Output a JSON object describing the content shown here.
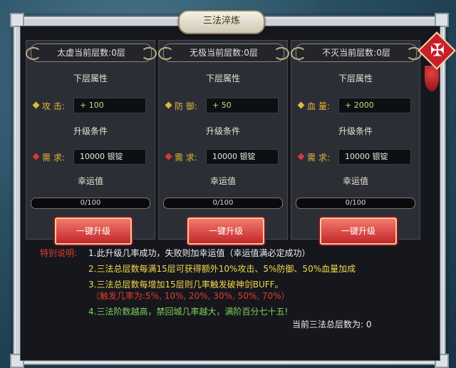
{
  "window": {
    "title": "三法淬炼",
    "close_icon": "✠"
  },
  "columns": [
    {
      "header": "太虚当前层数:0层",
      "next_attr": "下层属性",
      "stat": {
        "label": "攻  击:",
        "value": "+ 100"
      },
      "upgrade_cond": "升级条件",
      "require": {
        "label": "需  求:",
        "value": "10000 银锭"
      },
      "luck_title": "幸运值",
      "luck_bar": "0/100",
      "button": "一键升级"
    },
    {
      "header": "无极当前层数:0层",
      "next_attr": "下层属性",
      "stat": {
        "label": "防  御:",
        "value": "+ 50"
      },
      "upgrade_cond": "升级条件",
      "require": {
        "label": "需  求:",
        "value": "10000 银锭"
      },
      "luck_title": "幸运值",
      "luck_bar": "0/100",
      "button": "一键升级"
    },
    {
      "header": "不灭当前层数:0层",
      "next_attr": "下层属性",
      "stat": {
        "label": "血  量:",
        "value": "+ 2000"
      },
      "upgrade_cond": "升级条件",
      "require": {
        "label": "需  求:",
        "value": "10000 银锭"
      },
      "luck_title": "幸运值",
      "luck_bar": "0/100",
      "button": "一键升级"
    }
  ],
  "notes": {
    "title": "特别说明:",
    "line1": "1.此升级几率成功，失败则加幸运值（幸运值满必定成功）",
    "line2": "2.三法总层数每满15层可获得额外10%攻击、5%防御、50%血量加成",
    "line3": "3.三法总层数每增加15层则几率触发破神剑BUFF。",
    "line3b": "（触发几率为:5%, 10%, 20%, 30%, 50%, 70%）",
    "line4": "4.三法阶数越高，禁回城几率越大，满阶百分七十五!",
    "total": "当前三法总层数为: 0"
  },
  "colors": {
    "stat_diamond": "#e0b63c",
    "require_diamond": "#d43a3a",
    "note_red": "#e23b2d",
    "note_yellow": "#f2d94a",
    "note_green": "#7ed15a"
  }
}
